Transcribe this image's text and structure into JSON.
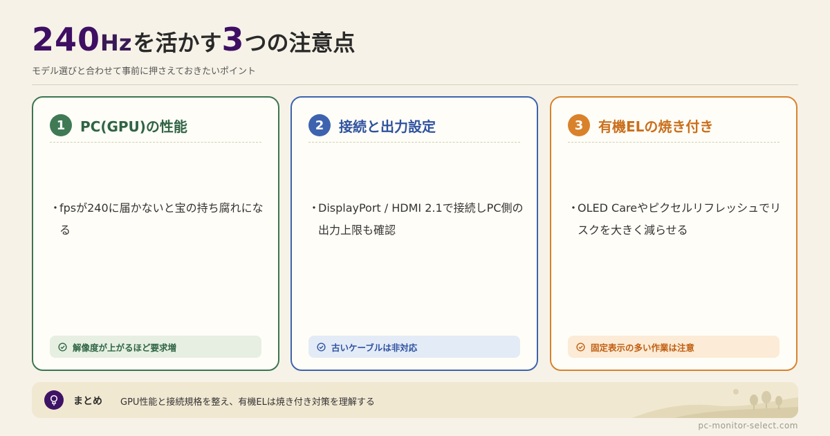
{
  "title": {
    "number_a": "240",
    "hz": "Hz",
    "text_a": "を活かす",
    "number_b": "3",
    "text_b": "つの注意点"
  },
  "subtitle": "モデル選びと合わせて事前に押さえておきたいポイント",
  "cards": [
    {
      "number": "1",
      "title": "PC(GPU)の性能",
      "bullet_mark": "・",
      "bullet": "fpsが240に届かないと宝の持ち腐れになる",
      "note": "解像度が上がるほど要求増",
      "color": "#3f7a55"
    },
    {
      "number": "2",
      "title": "接続と出力設定",
      "bullet_mark": "・",
      "bullet": "DisplayPort / HDMI 2.1で接続しPC側の出力上限も確認",
      "note": "古いケーブルは非対応",
      "color": "#3d63ae"
    },
    {
      "number": "3",
      "title": "有機ELの焼き付き",
      "bullet_mark": "・",
      "bullet": "OLED Careやピクセルリフレッシュでリスクを大きく減らせる",
      "note": "固定表示の多い作業は注意",
      "color": "#d9822b"
    }
  ],
  "summary": {
    "icon": "lightbulb-icon",
    "label": "まとめ",
    "text": "GPU性能と接続規格を整え、有機ELは焼き付き対策を理解する"
  },
  "site": "pc-monitor-select.com"
}
